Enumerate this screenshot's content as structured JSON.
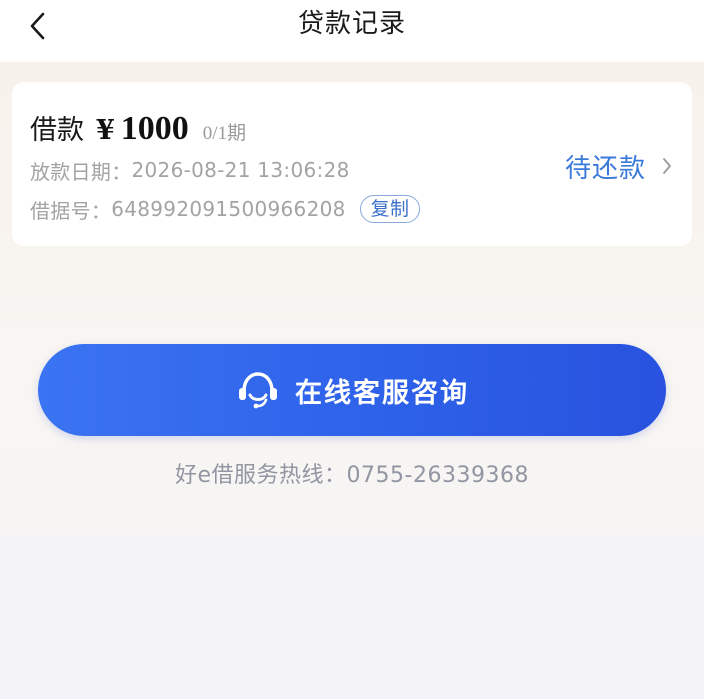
{
  "nav": {
    "title": "贷款记录"
  },
  "loan": {
    "label": "借款",
    "currency": "¥",
    "amount": "1000",
    "term": "0/1期",
    "date_label": "放款日期：",
    "date_value": "2026-08-21 13:06:28",
    "receipt_label": "借据号：",
    "receipt_value": "648992091500966208",
    "copy_label": "复制",
    "status": "待还款"
  },
  "consult": {
    "label": "在线客服咨询"
  },
  "hotline": {
    "text": "好e借服务热线：0755-26339368"
  },
  "colors": {
    "accent": "#3a7ad8",
    "button": "#2e63ea"
  }
}
